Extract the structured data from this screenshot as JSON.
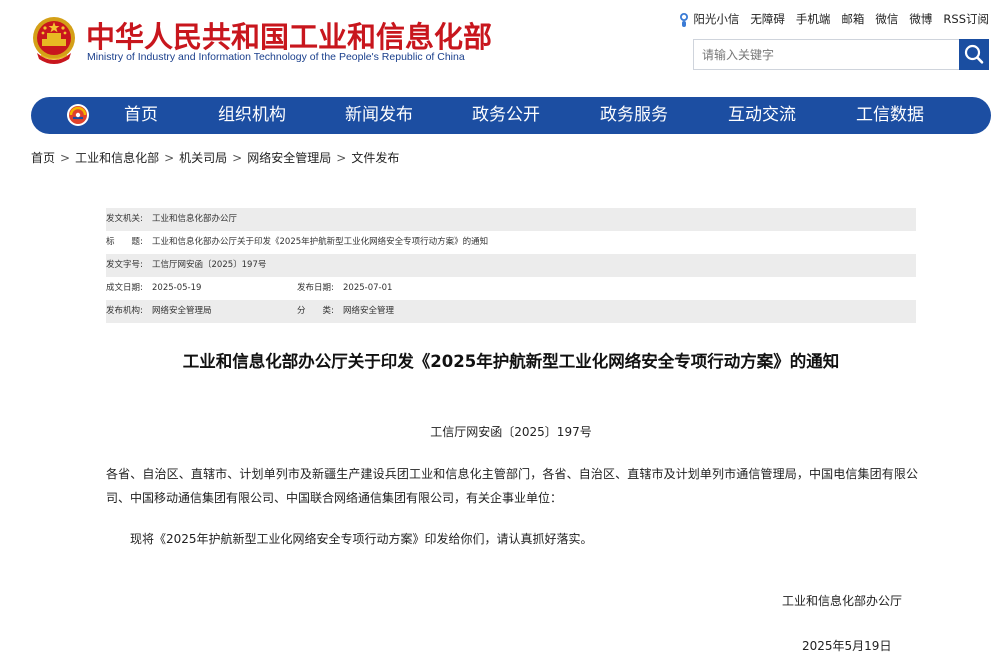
{
  "header": {
    "title_cn": "中华人民共和国工业和信息化部",
    "title_en": "Ministry of Industry and Information Technology of the People's Republic of China",
    "brand_color": "#c8161d",
    "accent_color": "#1c4ea2"
  },
  "toplinks": [
    {
      "label": "阳光小信",
      "icon": "sun-mascot-icon"
    },
    {
      "label": "无障碍"
    },
    {
      "label": "手机端"
    },
    {
      "label": "邮箱"
    },
    {
      "label": "微信"
    },
    {
      "label": "微博"
    },
    {
      "label": "RSS订阅"
    }
  ],
  "search": {
    "placeholder": "请输入关键字",
    "icon": "search-icon"
  },
  "nav": {
    "logo_icon": "ministry-logo-icon",
    "items": [
      {
        "label": "首页"
      },
      {
        "label": "组织机构"
      },
      {
        "label": "新闻发布"
      },
      {
        "label": "政务公开"
      },
      {
        "label": "政务服务"
      },
      {
        "label": "互动交流"
      },
      {
        "label": "工信数据"
      }
    ]
  },
  "breadcrumb": {
    "separator": ">",
    "items": [
      "首页",
      "工业和信息化部",
      "机关司局",
      "网络安全管理局",
      "文件发布"
    ]
  },
  "meta": {
    "issuer_label": "发文机关:",
    "issuer": "工业和信息化部办公厅",
    "title_label": "标　　题:",
    "title": "工业和信息化部办公厅关于印发《2025年护航新型工业化网络安全专项行动方案》的通知",
    "doc_no_label": "发文字号:",
    "doc_no": "工信厅网安函〔2025〕197号",
    "date_written_label": "成文日期:",
    "date_written": "2025-05-19",
    "date_published_label": "发布日期:",
    "date_published": "2025-07-01",
    "agency_label": "发布机构:",
    "agency": "网络安全管理局",
    "category_label": "分　　类:",
    "category": "网络安全管理"
  },
  "article": {
    "title": "工业和信息化部办公厅关于印发《2025年护航新型工业化网络安全专项行动方案》的通知",
    "doc_number": "工信厅网安函〔2025〕197号",
    "recipients": "各省、自治区、直辖市、计划单列市及新疆生产建设兵团工业和信息化主管部门，各省、自治区、直辖市及计划单列市通信管理局，中国电信集团有限公司、中国移动通信集团有限公司、中国联合网络通信集团有限公司，有关企事业单位：",
    "body": "现将《2025年护航新型工业化网络安全专项行动方案》印发给你们，请认真抓好落实。",
    "signature_org": "工业和信息化部办公厅",
    "signature_date": "2025年5月19日"
  }
}
